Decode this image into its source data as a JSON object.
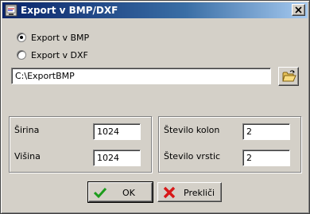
{
  "window": {
    "title": "Export v BMP/DXF"
  },
  "export": {
    "options": [
      {
        "label": "Export v BMP",
        "selected": true
      },
      {
        "label": "Export v DXF",
        "selected": false
      }
    ],
    "path": "C:\\ExportBMP"
  },
  "size": {
    "width_label": "Širina",
    "width_value": "1024",
    "height_label": "Višina",
    "height_value": "1024"
  },
  "grid": {
    "columns_label": "Število kolon",
    "columns_value": "2",
    "rows_label": "Število vrstic",
    "rows_value": "2"
  },
  "buttons": {
    "ok": "OK",
    "cancel": "Prekliči"
  },
  "colors": {
    "titlebar_start": "#0a246a",
    "titlebar_end": "#a6caf0",
    "face": "#d4d0c8"
  }
}
